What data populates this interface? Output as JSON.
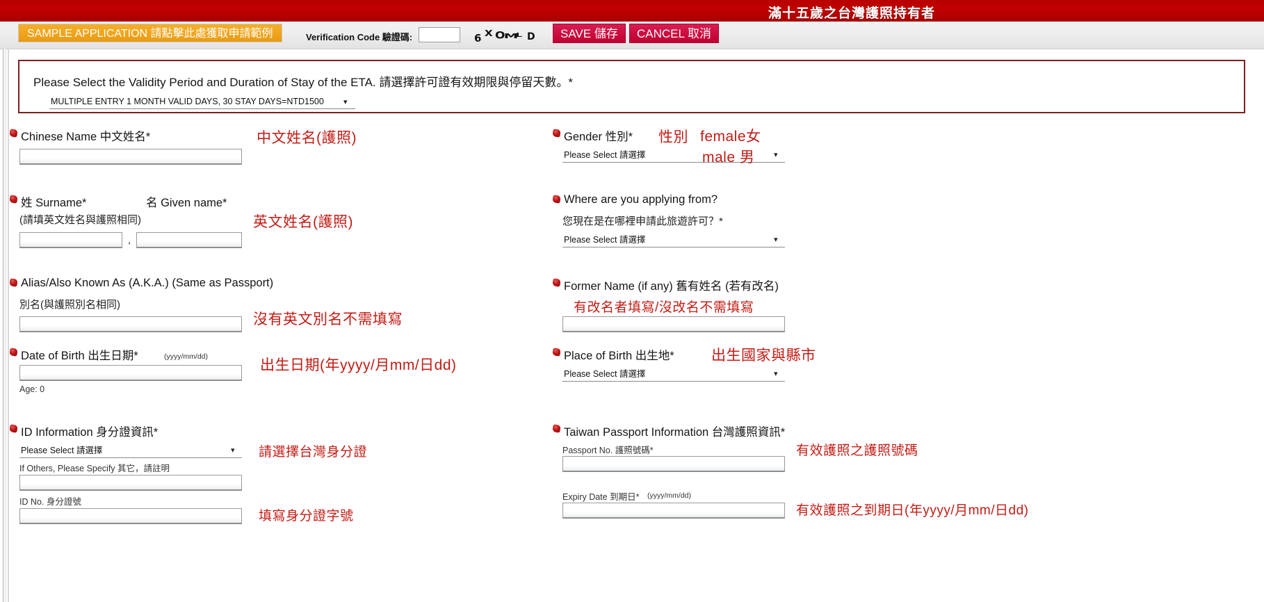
{
  "header": {
    "title": "滿十五歲之台灣護照持有者"
  },
  "toolbar": {
    "sample_label": "SAMPLE APPLICATION 請點擊此處獲取申請範例",
    "verification_label": "Verification Code 驗證碼:",
    "verification_value": "",
    "captcha_chars": [
      "6",
      "X",
      "O",
      "M",
      "L",
      "D"
    ],
    "save_label": "SAVE 儲存",
    "cancel_label": "CANCEL 取消"
  },
  "validity": {
    "question": "Please Select the Validity Period and Duration of Stay of the ETA. 請選擇許可證有效期限與停留天數。*",
    "selected": "MULTIPLE ENTRY 1 MONTH VALID DAYS, 30 STAY DAYS=NTD1500"
  },
  "left": {
    "chinese_name": {
      "label": "Chinese Name 中文姓名*",
      "value": "",
      "annotation": "中文姓名(護照)"
    },
    "english_name": {
      "label_surname": "姓 Surname*",
      "label_given": "名 Given name*",
      "note": "(請填英文姓名與護照相同)",
      "surname_value": "",
      "given_value": "",
      "separator": ",",
      "annotation": "英文姓名(護照)"
    },
    "alias": {
      "label": "Alias/Also Known As (A.K.A.) (Same as Passport)",
      "sub_label": "別名(與護照別名相同)",
      "value": "",
      "annotation": "沒有英文別名不需填寫"
    },
    "dob": {
      "label": "Date of Birth 出生日期*",
      "format": "(yyyy/mm/dd)",
      "value": "",
      "age_text": "Age: 0",
      "annotation": "出生日期(年yyyy/月mm/日dd)"
    },
    "id_info": {
      "label": "ID Information 身分證資訊*",
      "select_value": "Please Select 請選擇",
      "other_label": "If Others, Please Specify 其它，請註明",
      "other_value": "",
      "idno_label": "ID No. 身分證號",
      "idno_value": "",
      "annotation_select": "請選擇台灣身分證",
      "annotation_idno": "填寫身分證字號"
    }
  },
  "right": {
    "gender": {
      "label": "Gender 性別*",
      "select_value": "Please Select 請選擇",
      "annotation_1": "性別",
      "annotation_2": "female女",
      "annotation_3": "male 男"
    },
    "applying_from": {
      "label": "Where are you applying from?",
      "sub_label": "您現在是在哪裡申請此旅遊許可？*",
      "select_value": "Please Select 請選擇"
    },
    "former_name": {
      "label": "Former Name (if any) 舊有姓名 (若有改名)",
      "value": "",
      "annotation": "有改名者填寫/沒改名不需填寫"
    },
    "place_of_birth": {
      "label": "Place of Birth 出生地*",
      "select_value": "Please Select 請選擇",
      "annotation": "出生國家與縣市"
    },
    "passport": {
      "label": "Taiwan Passport Information 台灣護照資訊*",
      "no_label": "Passport No. 護照號碼*",
      "no_value": "",
      "expiry_label": "Expiry Date 到期日*",
      "expiry_format": "(yyyy/mm/dd)",
      "expiry_value": "",
      "annotation_no": "有效護照之護照號碼",
      "annotation_expiry": "有效護照之到期日(年yyyy/月mm/日dd)"
    }
  }
}
